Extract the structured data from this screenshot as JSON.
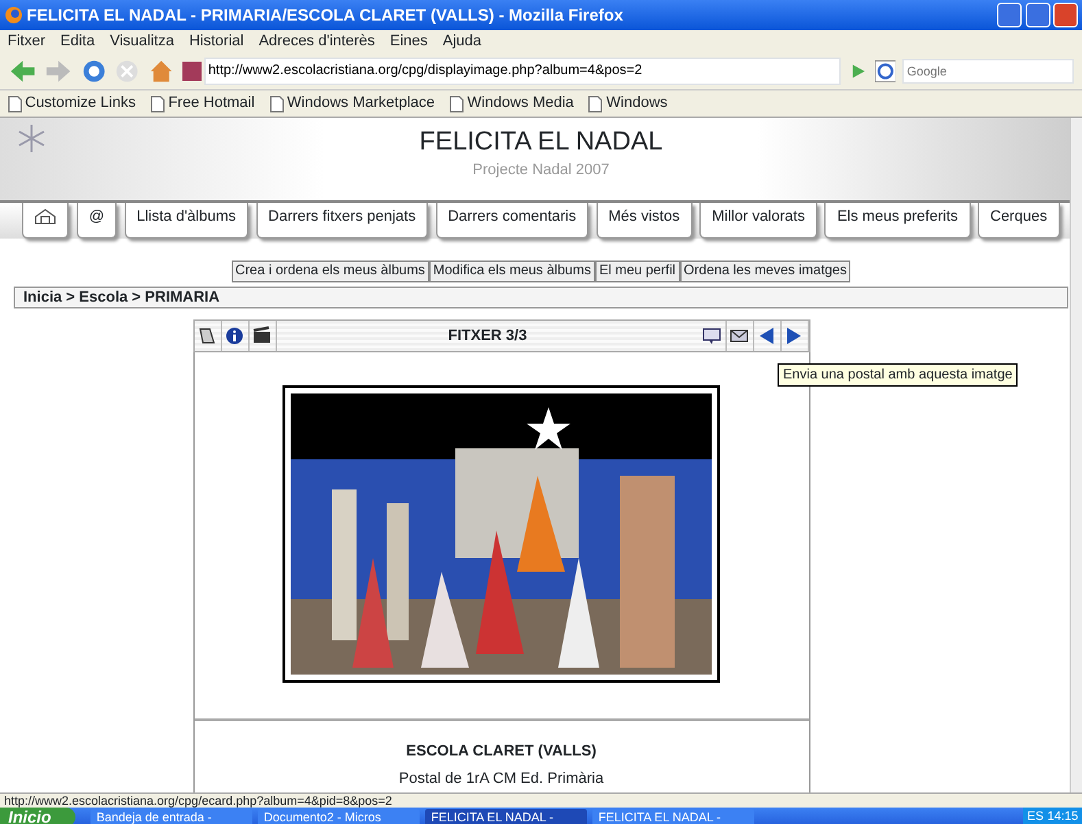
{
  "window": {
    "title": "FELICITA EL NADAL - PRIMARIA/ESCOLA CLARET (VALLS) - Mozilla Firefox"
  },
  "menu": [
    "Fitxer",
    "Edita",
    "Visualitza",
    "Historial",
    "Adreces d'interès",
    "Eines",
    "Ajuda"
  ],
  "address": {
    "value": "http://www2.escolacristiana.org/cpg/displayimage.php?album=4&pos=2"
  },
  "search": {
    "placeholder": "Google"
  },
  "bookmarks": [
    "Customize Links",
    "Free Hotmail",
    "Windows Marketplace",
    "Windows Media",
    "Windows"
  ],
  "site": {
    "title": "FELICITA EL NADAL",
    "subtitle": "Projecte Nadal 2007"
  },
  "tabs": [
    {
      "kind": "icon"
    },
    {
      "kind": "text",
      "label": "@"
    },
    {
      "kind": "text",
      "label": "Llista d'àlbums"
    },
    {
      "kind": "text",
      "label": "Darrers fitxers penjats"
    },
    {
      "kind": "text",
      "label": "Darrers comentaris"
    },
    {
      "kind": "text",
      "label": "Més vistos"
    },
    {
      "kind": "text",
      "label": "Millor valorats"
    },
    {
      "kind": "text",
      "label": "Els meus preferits"
    },
    {
      "kind": "text",
      "label": "Cerques"
    }
  ],
  "user_links": [
    "Crea i ordena els meus àlbums",
    "Modifica els meus àlbums",
    "El meu perfil",
    "Ordena les meves imatges"
  ],
  "breadcrumb": "Inicia > Escola > PRIMARIA",
  "file_toolbar": {
    "title": "FITXER 3/3"
  },
  "tooltip": "Envia una postal amb aquesta imatge",
  "caption": {
    "title": "ESCOLA CLARET (VALLS)",
    "description": "Postal de 1rA CM Ed. Primària"
  },
  "status_bar": "http://www2.escolacristiana.org/cpg/ecard.php?album=4&pid=8&pos=2",
  "taskbar": {
    "start": "Inicio",
    "tasks": [
      {
        "label": "Bandeja de entrada -",
        "selected": false
      },
      {
        "label": "Documento2 - Micros",
        "selected": false
      },
      {
        "label": "FELICITA EL NADAL -",
        "selected": true
      },
      {
        "label": "FELICITA EL NADAL -",
        "selected": false
      }
    ],
    "language": "ES",
    "clock": "14:15"
  }
}
